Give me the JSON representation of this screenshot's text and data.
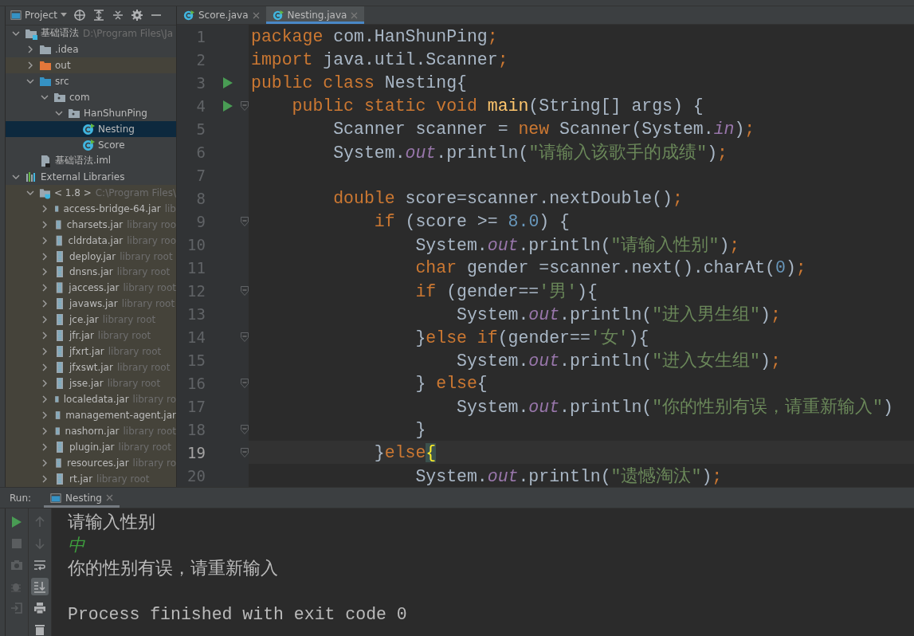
{
  "project_panel": {
    "title": "Project",
    "tree": [
      {
        "label": "基础语法",
        "detail": "D:\\Program Files\\Ja",
        "kind": "module",
        "expanded": true,
        "selected": false,
        "children": [
          {
            "label": ".idea",
            "kind": "folder",
            "expanded": false,
            "selected": false
          },
          {
            "label": "out",
            "kind": "excluded",
            "expanded": false,
            "selected": false
          },
          {
            "label": "src",
            "kind": "source",
            "expanded": true,
            "selected": false,
            "children": [
              {
                "label": "com",
                "kind": "package",
                "expanded": true,
                "selected": false,
                "children": [
                  {
                    "label": "HanShunPing",
                    "kind": "package",
                    "expanded": true,
                    "selected": false,
                    "children": [
                      {
                        "label": "Nesting",
                        "kind": "class",
                        "selected": true
                      },
                      {
                        "label": "Score",
                        "kind": "class",
                        "selected": false
                      }
                    ]
                  }
                ]
              }
            ]
          },
          {
            "label": "基础语法.iml",
            "kind": "iml",
            "selected": false
          }
        ]
      },
      {
        "label": "External Libraries",
        "kind": "libraries",
        "expanded": true,
        "selected": false,
        "children": [
          {
            "label": "< 1.8 >",
            "detail": "C:\\Program Files\\",
            "kind": "jdk",
            "expanded": true,
            "selected": false,
            "children": [
              {
                "label": "access-bridge-64.jar",
                "detail": "lib",
                "kind": "jar",
                "expanded": false,
                "selected": false
              },
              {
                "label": "charsets.jar",
                "detail": "library roo",
                "kind": "jar",
                "expanded": false,
                "selected": false
              },
              {
                "label": "cldrdata.jar",
                "detail": "library roo",
                "kind": "jar",
                "expanded": false,
                "selected": false
              },
              {
                "label": "deploy.jar",
                "detail": "library root",
                "kind": "jar",
                "expanded": false,
                "selected": false
              },
              {
                "label": "dnsns.jar",
                "detail": "library root",
                "kind": "jar",
                "expanded": false,
                "selected": false
              },
              {
                "label": "jaccess.jar",
                "detail": "library root",
                "kind": "jar",
                "expanded": false,
                "selected": false
              },
              {
                "label": "javaws.jar",
                "detail": "library root",
                "kind": "jar",
                "expanded": false,
                "selected": false
              },
              {
                "label": "jce.jar",
                "detail": "library root",
                "kind": "jar",
                "expanded": false,
                "selected": false
              },
              {
                "label": "jfr.jar",
                "detail": "library root",
                "kind": "jar",
                "expanded": false,
                "selected": false
              },
              {
                "label": "jfxrt.jar",
                "detail": "library root",
                "kind": "jar",
                "expanded": false,
                "selected": false
              },
              {
                "label": "jfxswt.jar",
                "detail": "library root",
                "kind": "jar",
                "expanded": false,
                "selected": false
              },
              {
                "label": "jsse.jar",
                "detail": "library root",
                "kind": "jar",
                "expanded": false,
                "selected": false
              },
              {
                "label": "localedata.jar",
                "detail": "library ro",
                "kind": "jar",
                "expanded": false,
                "selected": false
              },
              {
                "label": "management-agent.jar",
                "kind": "jar",
                "expanded": false,
                "selected": false
              },
              {
                "label": "nashorn.jar",
                "detail": "library root",
                "kind": "jar",
                "expanded": false,
                "selected": false
              },
              {
                "label": "plugin.jar",
                "detail": "library root",
                "kind": "jar",
                "expanded": false,
                "selected": false
              },
              {
                "label": "resources.jar",
                "detail": "library ro",
                "kind": "jar",
                "expanded": false,
                "selected": false
              },
              {
                "label": "rt.jar",
                "detail": "library root",
                "kind": "jar",
                "expanded": false,
                "selected": false
              }
            ]
          }
        ]
      }
    ]
  },
  "editor_tabs": [
    {
      "label": "Score.java",
      "selected": false
    },
    {
      "label": "Nesting.java",
      "selected": true
    }
  ],
  "code_lines": [
    {
      "number": "1",
      "run_marker": false,
      "fold": false,
      "current": false,
      "tokens": [
        {
          "kind": "kw",
          "text": "package"
        },
        {
          "kind": "plain",
          "text": " com.HanShunPing"
        },
        {
          "kind": "punct",
          "text": ";"
        }
      ]
    },
    {
      "number": "2",
      "run_marker": false,
      "fold": false,
      "current": false,
      "tokens": [
        {
          "kind": "kw",
          "text": "import"
        },
        {
          "kind": "plain",
          "text": " java.util.Scanner"
        },
        {
          "kind": "punct",
          "text": ";"
        }
      ]
    },
    {
      "number": "3",
      "run_marker": true,
      "fold": false,
      "current": false,
      "tokens": [
        {
          "kind": "kw",
          "text": "public class"
        },
        {
          "kind": "plain",
          "text": " Nesting{"
        }
      ]
    },
    {
      "number": "4",
      "run_marker": true,
      "fold": true,
      "current": false,
      "tokens": [
        {
          "kind": "kw",
          "text": "    public static void "
        },
        {
          "kind": "method",
          "text": "main"
        },
        {
          "kind": "plain",
          "text": "(String[] args) {"
        }
      ]
    },
    {
      "number": "5",
      "run_marker": false,
      "fold": false,
      "current": false,
      "tokens": [
        {
          "kind": "plain",
          "text": "        Scanner scanner = "
        },
        {
          "kind": "kw",
          "text": "new"
        },
        {
          "kind": "plain",
          "text": " Scanner(System."
        },
        {
          "kind": "field",
          "text": "in"
        },
        {
          "kind": "plain",
          "text": ")"
        },
        {
          "kind": "punct",
          "text": ";"
        }
      ]
    },
    {
      "number": "6",
      "run_marker": false,
      "fold": false,
      "current": false,
      "tokens": [
        {
          "kind": "plain",
          "text": "        System."
        },
        {
          "kind": "field",
          "text": "out"
        },
        {
          "kind": "plain",
          "text": ".println("
        },
        {
          "kind": "string",
          "text": "\"请输入该歌手的成绩\""
        },
        {
          "kind": "plain",
          "text": ")"
        },
        {
          "kind": "punct",
          "text": ";"
        }
      ]
    },
    {
      "number": "7",
      "run_marker": false,
      "fold": false,
      "current": false
    },
    {
      "number": "8",
      "run_marker": false,
      "fold": false,
      "current": false,
      "tokens": [
        {
          "kind": "kw",
          "text": "        double"
        },
        {
          "kind": "plain",
          "text": " score=scanner.nextDouble()"
        },
        {
          "kind": "punct",
          "text": ";"
        }
      ]
    },
    {
      "number": "9",
      "run_marker": false,
      "fold": true,
      "current": false,
      "tokens": [
        {
          "kind": "kw",
          "text": "            if"
        },
        {
          "kind": "plain",
          "text": " (score >= "
        },
        {
          "kind": "number",
          "text": "8.0"
        },
        {
          "kind": "plain",
          "text": ") {"
        }
      ]
    },
    {
      "number": "10",
      "run_marker": false,
      "fold": false,
      "current": false,
      "tokens": [
        {
          "kind": "plain",
          "text": "                System."
        },
        {
          "kind": "field",
          "text": "out"
        },
        {
          "kind": "plain",
          "text": ".println("
        },
        {
          "kind": "string",
          "text": "\"请输入性别\""
        },
        {
          "kind": "plain",
          "text": ")"
        },
        {
          "kind": "punct",
          "text": ";"
        }
      ]
    },
    {
      "number": "11",
      "run_marker": false,
      "fold": false,
      "current": false,
      "tokens": [
        {
          "kind": "kw",
          "text": "                char"
        },
        {
          "kind": "plain",
          "text": " gender =scanner.next().charAt("
        },
        {
          "kind": "number",
          "text": "0"
        },
        {
          "kind": "plain",
          "text": ")"
        },
        {
          "kind": "punct",
          "text": ";"
        }
      ]
    },
    {
      "number": "12",
      "run_marker": false,
      "fold": true,
      "current": false,
      "tokens": [
        {
          "kind": "kw",
          "text": "                if"
        },
        {
          "kind": "plain",
          "text": " (gender=="
        },
        {
          "kind": "string",
          "text": "'男'"
        },
        {
          "kind": "plain",
          "text": "){"
        }
      ]
    },
    {
      "number": "13",
      "run_marker": false,
      "fold": false,
      "current": false,
      "tokens": [
        {
          "kind": "plain",
          "text": "                    System."
        },
        {
          "kind": "field",
          "text": "out"
        },
        {
          "kind": "plain",
          "text": ".println("
        },
        {
          "kind": "string",
          "text": "\"进入男生组\""
        },
        {
          "kind": "plain",
          "text": ")"
        },
        {
          "kind": "punct",
          "text": ";"
        }
      ]
    },
    {
      "number": "14",
      "run_marker": false,
      "fold": true,
      "current": false,
      "tokens": [
        {
          "kind": "plain",
          "text": "                }"
        },
        {
          "kind": "kw",
          "text": "else if"
        },
        {
          "kind": "plain",
          "text": "(gender=="
        },
        {
          "kind": "string",
          "text": "'女'"
        },
        {
          "kind": "plain",
          "text": "){"
        }
      ]
    },
    {
      "number": "15",
      "run_marker": false,
      "fold": false,
      "current": false,
      "tokens": [
        {
          "kind": "plain",
          "text": "                    System."
        },
        {
          "kind": "field",
          "text": "out"
        },
        {
          "kind": "plain",
          "text": ".println("
        },
        {
          "kind": "string",
          "text": "\"进入女生组\""
        },
        {
          "kind": "plain",
          "text": ")"
        },
        {
          "kind": "punct",
          "text": ";"
        }
      ]
    },
    {
      "number": "16",
      "run_marker": false,
      "fold": true,
      "current": false,
      "tokens": [
        {
          "kind": "plain",
          "text": "                } "
        },
        {
          "kind": "kw",
          "text": "else"
        },
        {
          "kind": "plain",
          "text": "{"
        }
      ]
    },
    {
      "number": "17",
      "run_marker": false,
      "fold": false,
      "current": false,
      "tokens": [
        {
          "kind": "plain",
          "text": "                    System."
        },
        {
          "kind": "field",
          "text": "out"
        },
        {
          "kind": "plain",
          "text": ".println("
        },
        {
          "kind": "string",
          "text": "\"你的性别有误，请重新输入\""
        },
        {
          "kind": "plain",
          "text": ")"
        }
      ]
    },
    {
      "number": "18",
      "run_marker": false,
      "fold": true,
      "current": false,
      "tokens": [
        {
          "kind": "plain",
          "text": "                }"
        }
      ]
    },
    {
      "number": "19",
      "run_marker": false,
      "fold": true,
      "current": true,
      "tokens": [
        {
          "kind": "plain",
          "text": "            }"
        },
        {
          "kind": "kw",
          "text": "else"
        },
        {
          "kind": "match",
          "text": "{"
        }
      ]
    },
    {
      "number": "20",
      "run_marker": false,
      "fold": false,
      "current": false,
      "tokens": [
        {
          "kind": "plain",
          "text": "                System."
        },
        {
          "kind": "field",
          "text": "out"
        },
        {
          "kind": "plain",
          "text": ".println("
        },
        {
          "kind": "string",
          "text": "\"遗憾淘汰\""
        },
        {
          "kind": "plain",
          "text": ")"
        },
        {
          "kind": "punct",
          "text": ";"
        }
      ]
    }
  ],
  "run_panel": {
    "label": "Run:",
    "tabs": [
      {
        "label": "Nesting",
        "selected": true
      }
    ],
    "scroll_to_end": {
      "on": true
    },
    "output": [
      {
        "kind": "output",
        "text": "请输入性别"
      },
      {
        "kind": "input",
        "text": "中"
      },
      {
        "kind": "output",
        "text": "你的性别有误，请重新输入"
      },
      {
        "kind": "system",
        "text": "Process finished with exit code 0"
      }
    ]
  }
}
